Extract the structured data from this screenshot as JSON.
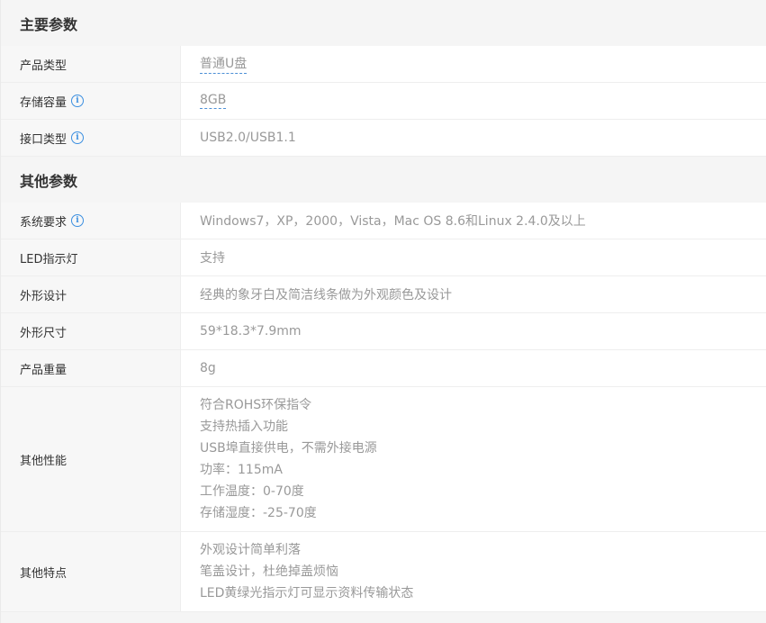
{
  "sections": [
    {
      "title": "主要参数",
      "rows": [
        {
          "label": "产品类型",
          "info": false,
          "values": [
            "普通U盘"
          ],
          "link": true
        },
        {
          "label": "存储容量",
          "info": true,
          "values": [
            "8GB"
          ],
          "link": true
        },
        {
          "label": "接口类型",
          "info": true,
          "values": [
            "USB2.0/USB1.1"
          ],
          "link": false
        }
      ]
    },
    {
      "title": "其他参数",
      "rows": [
        {
          "label": "系统要求",
          "info": true,
          "values": [
            "Windows7，XP，2000，Vista，Mac OS 8.6和Linux 2.4.0及以上"
          ],
          "link": false
        },
        {
          "label": "LED指示灯",
          "info": false,
          "values": [
            "支持"
          ],
          "link": false
        },
        {
          "label": "外形设计",
          "info": false,
          "values": [
            "经典的象牙白及简洁线条做为外观颜色及设计"
          ],
          "link": false
        },
        {
          "label": "外形尺寸",
          "info": false,
          "values": [
            "59*18.3*7.9mm"
          ],
          "link": false
        },
        {
          "label": "产品重量",
          "info": false,
          "values": [
            "8g"
          ],
          "link": false
        },
        {
          "label": "其他性能",
          "info": false,
          "values": [
            "符合ROHS环保指令",
            "支持热插入功能",
            "USB埠直接供电，不需外接电源",
            "功率：115mA",
            "工作温度：0-70度",
            "存储湿度：-25-70度"
          ],
          "link": false
        },
        {
          "label": "其他特点",
          "info": false,
          "values": [
            "外观设计简单利落",
            "笔盖设计，杜绝掉盖烦恼",
            "LED黄绿光指示灯可显示资料传输状态"
          ],
          "link": false
        }
      ]
    }
  ],
  "info_icon_glyph": "i",
  "colors": {
    "info_icon": "#3b8fe0",
    "link_underline": "#4c8fd6",
    "section_bg": "#f5f5f5",
    "label_bg": "#f7f7f7"
  }
}
